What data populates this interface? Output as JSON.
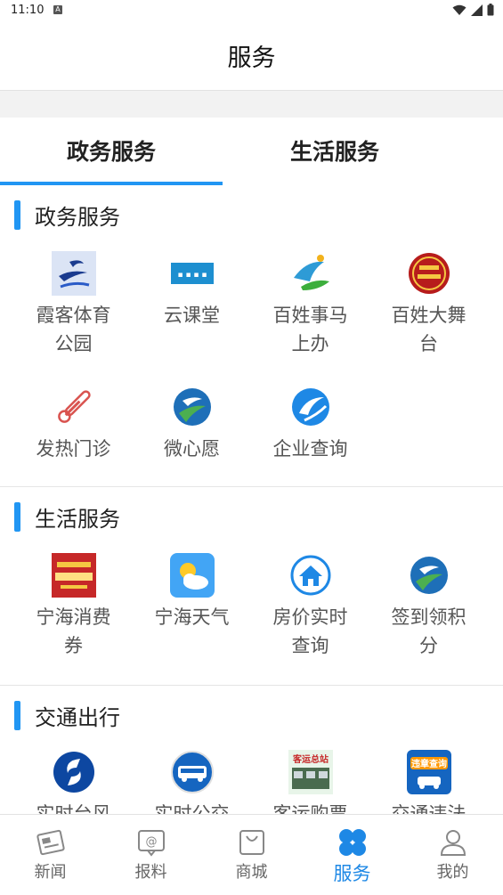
{
  "status": {
    "time": "11:10",
    "notif": "A"
  },
  "header": {
    "title": "服务"
  },
  "tabs": [
    {
      "label": "政务服务",
      "active": true
    },
    {
      "label": "生活服务",
      "active": false
    }
  ],
  "sections": [
    {
      "title": "政务服务",
      "items": [
        {
          "line1": "霞客体育",
          "line2": "公园",
          "icon": "xiake-sports-icon"
        },
        {
          "line1": "云课堂",
          "line2": "",
          "icon": "cloud-class-icon"
        },
        {
          "line1": "百姓事马",
          "line2": "上办",
          "icon": "quick-service-icon"
        },
        {
          "line1": "百姓大舞",
          "line2": "台",
          "icon": "stage-icon"
        },
        {
          "line1": "发热门诊",
          "line2": "",
          "icon": "thermometer-icon"
        },
        {
          "line1": "微心愿",
          "line2": "",
          "icon": "micro-wish-icon"
        },
        {
          "line1": "企业查询",
          "line2": "",
          "icon": "enterprise-query-icon"
        }
      ]
    },
    {
      "title": "生活服务",
      "items": [
        {
          "line1": "宁海消费",
          "line2": "券",
          "icon": "coupon-icon"
        },
        {
          "line1": "宁海天气",
          "line2": "",
          "icon": "weather-icon"
        },
        {
          "line1": "房价实时",
          "line2": "查询",
          "icon": "house-icon"
        },
        {
          "line1": "签到领积",
          "line2": "分",
          "icon": "checkin-icon"
        }
      ]
    },
    {
      "title": "交通出行",
      "items": [
        {
          "line1": "实时台风",
          "line2": "",
          "icon": "typhoon-icon"
        },
        {
          "line1": "实时公交",
          "line2": "",
          "icon": "bus-icon"
        },
        {
          "line1": "客运购票",
          "line2": "",
          "icon": "coach-ticket-icon",
          "badge": "客运总站"
        },
        {
          "line1": "交通违法",
          "line2": "",
          "icon": "traffic-violation-icon",
          "badge": "违章查询"
        }
      ]
    }
  ],
  "nav": [
    {
      "label": "新闻",
      "icon": "newspaper-icon",
      "active": false
    },
    {
      "label": "报料",
      "icon": "report-icon",
      "active": false
    },
    {
      "label": "商城",
      "icon": "shopping-bag-icon",
      "active": false
    },
    {
      "label": "服务",
      "icon": "service-grid-icon",
      "active": true
    },
    {
      "label": "我的",
      "icon": "profile-icon",
      "active": false
    }
  ],
  "colors": {
    "accent": "#2196f3",
    "nav_active": "#1e88e5"
  }
}
